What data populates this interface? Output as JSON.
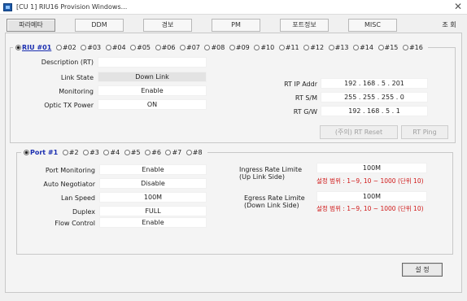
{
  "window": {
    "title": "[CU 1] RIU16 Provision Windows..."
  },
  "tabs": [
    "파라메타",
    "DDM",
    "경보",
    "PM",
    "포트정보",
    "MISC"
  ],
  "search_button": "조 회",
  "riu_selector": {
    "options": [
      "RIU #01",
      "#02",
      "#03",
      "#04",
      "#05",
      "#06",
      "#07",
      "#08",
      "#09",
      "#10",
      "#11",
      "#12",
      "#13",
      "#14",
      "#15",
      "#16"
    ],
    "selected_index": 0
  },
  "riu": {
    "description_label": "Description (RT)",
    "description_value": "",
    "link_state_label": "Link State",
    "link_state_value": "Down Link",
    "monitoring_label": "Monitoring",
    "monitoring_value": "Enable",
    "optic_tx_label": "Optic TX Power",
    "optic_tx_value": "ON",
    "ip_label": "RT IP Addr",
    "ip_value": "192 . 168 . 5 . 201",
    "sm_label": "RT S/M",
    "sm_value": "255 . 255 . 255 . 0",
    "gw_label": "RT G/W",
    "gw_value": "192 . 168 . 5 . 1",
    "reset_button": "(주의) RT Reset",
    "ping_button": "RT Ping"
  },
  "port_selector": {
    "options": [
      "Port #1",
      "#2",
      "#3",
      "#4",
      "#5",
      "#6",
      "#7",
      "#8"
    ],
    "selected_index": 0
  },
  "port": {
    "monitoring_label": "Port Monitoring",
    "monitoring_value": "Enable",
    "auto_neg_label": "Auto Negotiator",
    "auto_neg_value": "Disable",
    "lan_speed_label": "Lan Speed",
    "lan_speed_value": "100M",
    "duplex_label": "Duplex",
    "duplex_value": "FULL",
    "flow_label": "Flow Control",
    "flow_value": "Enable",
    "ingress_label_1": "Ingress Rate Limite",
    "ingress_label_2": "(Up Link Side)",
    "ingress_value": "100M",
    "ingress_note": "설정 범위 : 1~9, 10 ~ 1000 (단위 10)",
    "egress_label_1": "Egress Rate Limite",
    "egress_label_2": "(Down Link Side)",
    "egress_value": "100M",
    "egress_note": "설정 범위 : 1~9, 10 ~ 1000 (단위 10)"
  },
  "apply_button": "설 정"
}
